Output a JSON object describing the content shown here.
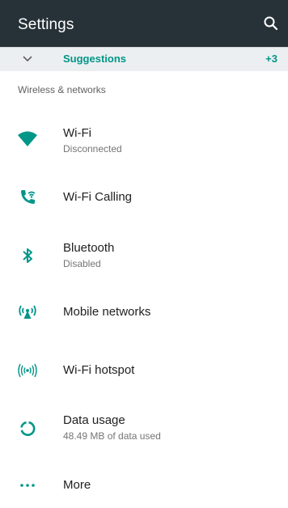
{
  "colors": {
    "appbar": "#263238",
    "accent": "#009688",
    "suggestions_bg": "#eceff1"
  },
  "appbar": {
    "title": "Settings",
    "icon": "search-icon"
  },
  "suggestions": {
    "label": "Suggestions",
    "count": "+3",
    "icon": "chevron-down-icon"
  },
  "section": {
    "header": "Wireless & networks"
  },
  "items": [
    {
      "title": "Wi-Fi",
      "subtitle": "Disconnected",
      "icon": "wifi-icon"
    },
    {
      "title": "Wi-Fi Calling",
      "icon": "wifi-calling-icon"
    },
    {
      "title": "Bluetooth",
      "subtitle": "Disabled",
      "icon": "bluetooth-icon"
    },
    {
      "title": "Mobile networks",
      "icon": "mobile-networks-icon"
    },
    {
      "title": "Wi-Fi hotspot",
      "icon": "hotspot-icon"
    },
    {
      "title": "Data usage",
      "subtitle": "48.49 MB of data used",
      "icon": "data-usage-icon"
    },
    {
      "title": "More",
      "icon": "more-icon"
    }
  ]
}
